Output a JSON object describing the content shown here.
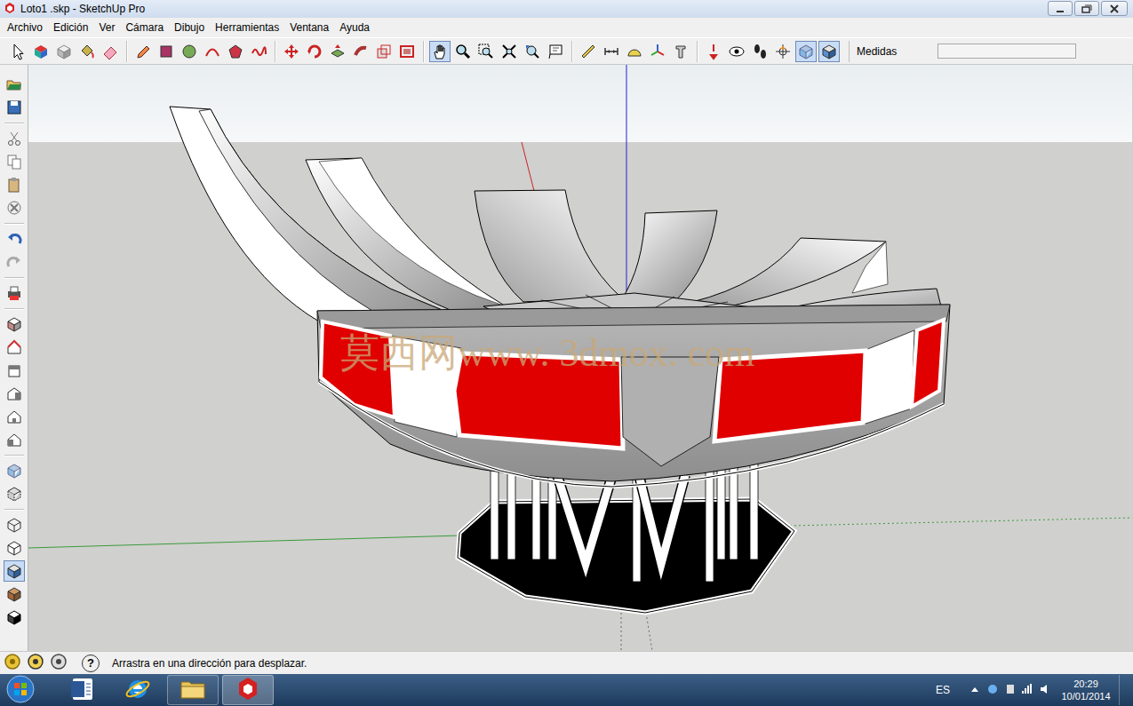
{
  "window": {
    "title": "Loto1 .skp - SketchUp Pro"
  },
  "menu": [
    "Archivo",
    "Edición",
    "Ver",
    "Cámara",
    "Dibujo",
    "Herramientas",
    "Ventana",
    "Ayuda"
  ],
  "toolbar": {
    "tools": [
      {
        "kind": "select",
        "selected": false
      },
      {
        "kind": "component",
        "selected": false
      },
      {
        "kind": "box",
        "selected": false
      },
      {
        "kind": "paint",
        "selected": false
      },
      {
        "kind": "eraser",
        "selected": false
      },
      {
        "kind": "pencil",
        "selected": false
      },
      {
        "kind": "rectangle",
        "selected": false
      },
      {
        "kind": "circle",
        "selected": false
      },
      {
        "kind": "arc",
        "selected": false
      },
      {
        "kind": "polygon",
        "selected": false
      },
      {
        "kind": "freehand",
        "selected": false
      },
      {
        "kind": "move",
        "selected": false
      },
      {
        "kind": "rotate",
        "selected": false
      },
      {
        "kind": "pushpull",
        "selected": false
      },
      {
        "kind": "followme",
        "selected": false
      },
      {
        "kind": "scale",
        "selected": false
      },
      {
        "kind": "offset",
        "selected": false
      },
      {
        "kind": "pan",
        "selected": true
      },
      {
        "kind": "zoom",
        "selected": false
      },
      {
        "kind": "zoomwindow",
        "selected": false
      },
      {
        "kind": "extents",
        "selected": false
      },
      {
        "kind": "previous",
        "selected": false
      },
      {
        "kind": "textlabel",
        "selected": false
      },
      {
        "kind": "tape",
        "selected": false
      },
      {
        "kind": "dimension",
        "selected": false
      },
      {
        "kind": "protractor",
        "selected": false
      },
      {
        "kind": "axes",
        "selected": false
      },
      {
        "kind": "text3d",
        "selected": false
      },
      {
        "kind": "camera",
        "selected": false
      },
      {
        "kind": "lookaround",
        "selected": false
      },
      {
        "kind": "walk",
        "selected": false
      },
      {
        "kind": "section",
        "selected": false
      },
      {
        "kind": "xray",
        "selected": true
      },
      {
        "kind": "shaded",
        "selected": true
      }
    ],
    "measurements": {
      "label": "Medidas"
    }
  },
  "side_toolbar": {
    "tools": [
      {
        "kind": "open",
        "selected": false
      },
      {
        "kind": "save",
        "selected": false
      },
      {
        "kind": "cut",
        "selected": false
      },
      {
        "kind": "copy",
        "selected": false
      },
      {
        "kind": "paste",
        "selected": false
      },
      {
        "kind": "erase",
        "selected": false
      },
      {
        "kind": "undo",
        "selected": false
      },
      {
        "kind": "redo",
        "selected": false
      },
      {
        "kind": "print",
        "selected": false
      },
      {
        "kind": "iso",
        "selected": false
      },
      {
        "kind": "top",
        "selected": false
      },
      {
        "kind": "front",
        "selected": false
      },
      {
        "kind": "right",
        "selected": false
      },
      {
        "kind": "back",
        "selected": false
      },
      {
        "kind": "left",
        "selected": false
      },
      {
        "kind": "xray",
        "selected": false
      },
      {
        "kind": "backedges",
        "selected": false
      },
      {
        "kind": "wireframe",
        "selected": false
      },
      {
        "kind": "hidden",
        "selected": false
      },
      {
        "kind": "shaded",
        "selected": true
      },
      {
        "kind": "textured",
        "selected": false
      },
      {
        "kind": "mono",
        "selected": false
      }
    ]
  },
  "viewport": {
    "watermark": "莫西网www. 3dmox. com"
  },
  "status_bar": {
    "help": "?",
    "text": "Arrastra en una dirección para desplazar."
  },
  "taskbar": {
    "apps": [
      {
        "kind": "word",
        "open": false,
        "selected": false
      },
      {
        "kind": "ie",
        "open": false,
        "selected": false
      },
      {
        "kind": "explorer",
        "open": true,
        "selected": false
      },
      {
        "kind": "sketchup",
        "open": true,
        "selected": true
      }
    ],
    "language": "ES",
    "time": "20:29",
    "date": "10/01/2014"
  }
}
